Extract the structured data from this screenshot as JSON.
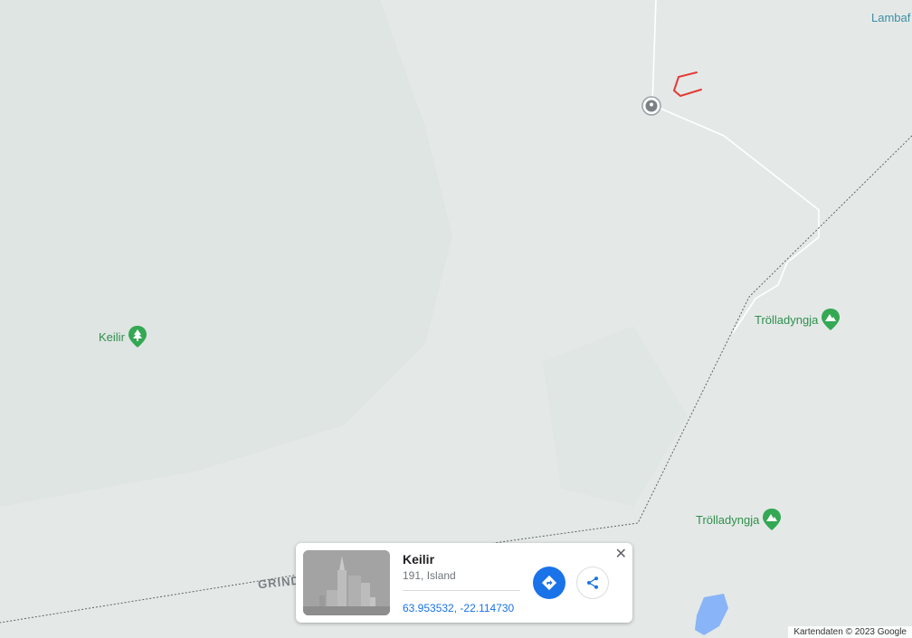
{
  "map": {
    "labels": {
      "lambaf": "Lambaf",
      "keilir": "Keilir",
      "trolladyngja_1": "Trölladyngja",
      "trolladyngja_2": "Trölladyngja",
      "road": "GRIND"
    },
    "colors": {
      "land": "#e4e9e7",
      "road": "#ffffff",
      "border": "#5f6368",
      "water": "#8ab4f8",
      "park_green": "#34a853",
      "annotation_red": "#e53935"
    }
  },
  "place_card": {
    "title": "Keilir",
    "subtitle": "191, Island",
    "coordinates": "63.953532, -22.114730",
    "directions_icon": "directions-icon",
    "share_icon": "share-icon",
    "close_label": "✕"
  },
  "footer": {
    "attribution": "Kartendaten © 2023 Google"
  }
}
